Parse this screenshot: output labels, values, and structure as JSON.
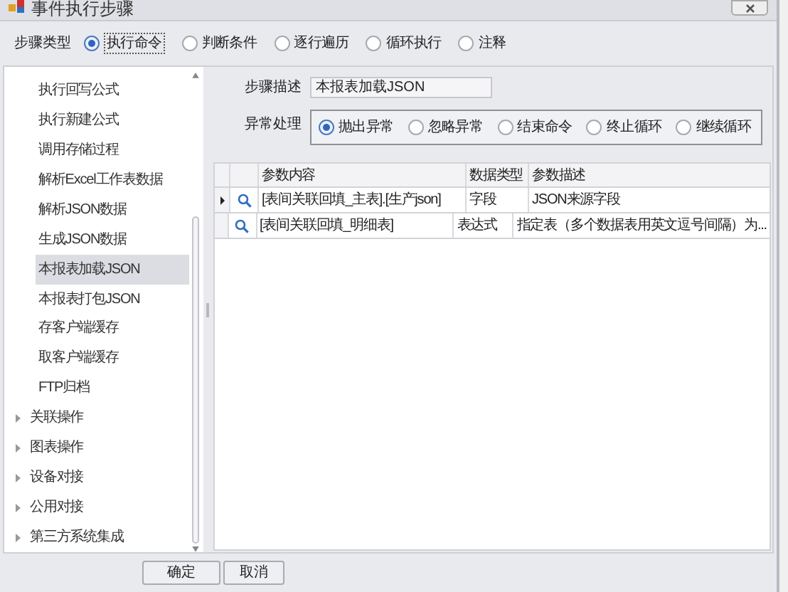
{
  "window": {
    "title": "事件执行步骤"
  },
  "step_type": {
    "label": "步骤类型",
    "options": [
      {
        "label": "执行命令",
        "selected": true
      },
      {
        "label": "判断条件",
        "selected": false
      },
      {
        "label": "逐行遍历",
        "selected": false
      },
      {
        "label": "循环执行",
        "selected": false
      },
      {
        "label": "注释",
        "selected": false
      }
    ]
  },
  "tree": {
    "items": [
      {
        "kind": "leaf",
        "label": "执行回写公式",
        "selected": false
      },
      {
        "kind": "leaf",
        "label": "执行新建公式",
        "selected": false
      },
      {
        "kind": "leaf",
        "label": "调用存储过程",
        "selected": false
      },
      {
        "kind": "leaf",
        "label": "解析Excel工作表数据",
        "selected": false
      },
      {
        "kind": "leaf",
        "label": "解析JSON数据",
        "selected": false
      },
      {
        "kind": "leaf",
        "label": "生成JSON数据",
        "selected": false
      },
      {
        "kind": "leaf",
        "label": "本报表加载JSON",
        "selected": true
      },
      {
        "kind": "leaf",
        "label": "本报表打包JSON",
        "selected": false
      },
      {
        "kind": "leaf",
        "label": "存客户端缓存",
        "selected": false
      },
      {
        "kind": "leaf",
        "label": "取客户端缓存",
        "selected": false
      },
      {
        "kind": "leaf",
        "label": "FTP归档",
        "selected": false
      },
      {
        "kind": "group",
        "label": "关联操作",
        "expanded": false
      },
      {
        "kind": "group",
        "label": "图表操作",
        "expanded": false
      },
      {
        "kind": "group",
        "label": "设备对接",
        "expanded": false
      },
      {
        "kind": "group",
        "label": "公用对接",
        "expanded": false
      },
      {
        "kind": "group",
        "label": "第三方系统集成",
        "expanded": false
      }
    ]
  },
  "step_description": {
    "label": "步骤描述",
    "value": "本报表加载JSON"
  },
  "exception_handling": {
    "label": "异常处理",
    "options": [
      {
        "label": "抛出异常",
        "selected": true
      },
      {
        "label": "忽略异常",
        "selected": false
      },
      {
        "label": "结束命令",
        "selected": false
      },
      {
        "label": "终止循环",
        "selected": false
      },
      {
        "label": "继续循环",
        "selected": false
      }
    ]
  },
  "table": {
    "columns": [
      "参数内容",
      "数据类型",
      "参数描述"
    ],
    "rows": [
      {
        "current": true,
        "content": "[表间关联回填_主表].[生产json]",
        "type": "字段",
        "description": "JSON来源字段"
      },
      {
        "current": false,
        "content": "[表间关联回填_明细表]",
        "type": "表达式",
        "description": "指定表（多个数据表用英文逗号间隔）为..."
      }
    ]
  },
  "buttons": [
    "确定",
    "取消"
  ]
}
